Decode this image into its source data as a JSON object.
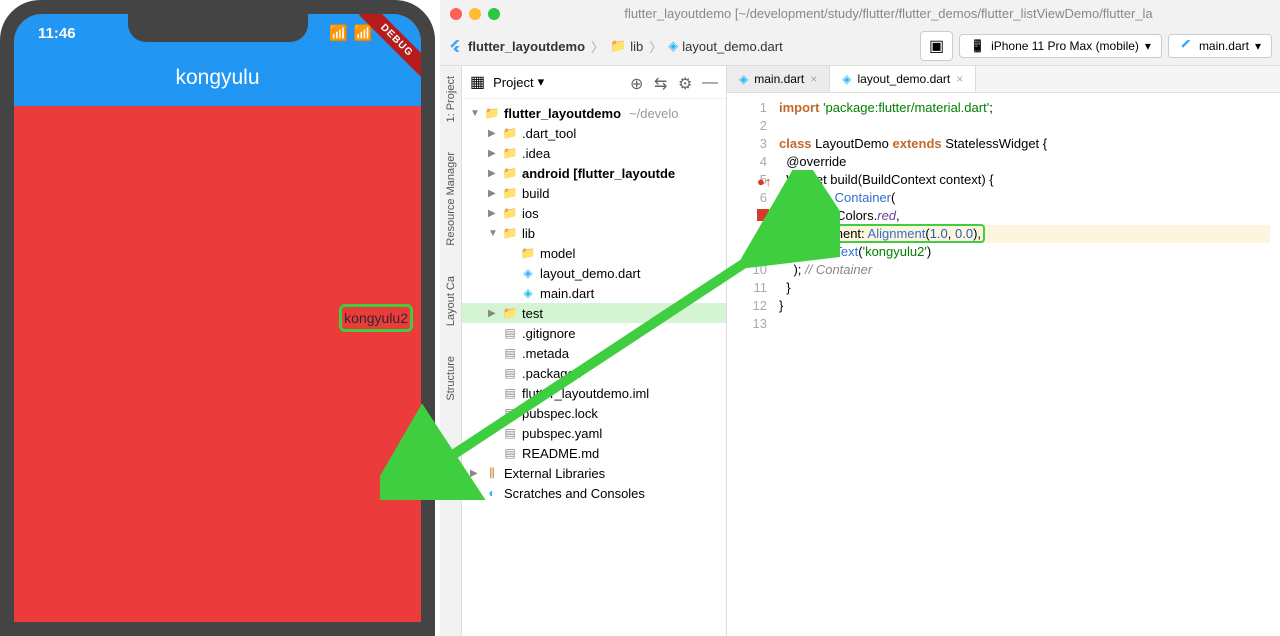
{
  "phone": {
    "time": "11:46",
    "title": "kongyulu",
    "body_text": "kongyulu2",
    "debug": "DEBUG"
  },
  "ide": {
    "window_title": "flutter_layoutdemo [~/development/study/flutter/flutter_demos/flutter_listViewDemo/flutter_la",
    "breadcrumb": [
      "flutter_layoutdemo",
      "lib",
      "layout_demo.dart"
    ],
    "device": "iPhone 11 Pro Max (mobile)",
    "run_config": "main.dart",
    "side_tabs": [
      "1: Project",
      "Resource Manager",
      "Layout Ca",
      "Structure"
    ],
    "project": {
      "title": "Project",
      "root": "flutter_layoutdemo",
      "root_path": "~/develo",
      "tree": [
        {
          "label": ".dart_tool",
          "icon": "folder-special",
          "indent": 1,
          "chevron": "▶"
        },
        {
          "label": ".idea",
          "icon": "folder-special",
          "indent": 1,
          "chevron": "▶"
        },
        {
          "label": "android [flutter_layoutde",
          "icon": "folder-special",
          "indent": 1,
          "chevron": "▶",
          "bold": true
        },
        {
          "label": "build",
          "icon": "folder-special",
          "indent": 1,
          "chevron": "▶"
        },
        {
          "label": "ios",
          "icon": "folder",
          "indent": 1,
          "chevron": "▶"
        },
        {
          "label": "lib",
          "icon": "folder",
          "indent": 1,
          "chevron": "▼"
        },
        {
          "label": "model",
          "icon": "folder",
          "indent": 2,
          "chevron": ""
        },
        {
          "label": "layout_demo.dart",
          "icon": "dart",
          "indent": 2,
          "chevron": ""
        },
        {
          "label": "main.dart",
          "icon": "dart",
          "indent": 2,
          "chevron": ""
        },
        {
          "label": "test",
          "icon": "folder-test",
          "indent": 1,
          "chevron": "▶",
          "selected": true
        },
        {
          "label": ".gitignore",
          "icon": "file",
          "indent": 1,
          "chevron": ""
        },
        {
          "label": ".metada",
          "icon": "file",
          "indent": 1,
          "chevron": ""
        },
        {
          "label": ".packages",
          "icon": "file",
          "indent": 1,
          "chevron": ""
        },
        {
          "label": "flutter_layoutdemo.iml",
          "icon": "file",
          "indent": 1,
          "chevron": ""
        },
        {
          "label": "pubspec.lock",
          "icon": "file",
          "indent": 1,
          "chevron": ""
        },
        {
          "label": "pubspec.yaml",
          "icon": "file",
          "indent": 1,
          "chevron": ""
        },
        {
          "label": "README.md",
          "icon": "file",
          "indent": 1,
          "chevron": ""
        },
        {
          "label": "External Libraries",
          "icon": "lib",
          "indent": 0,
          "chevron": "▶"
        },
        {
          "label": "Scratches and Consoles",
          "icon": "scratch",
          "indent": 0,
          "chevron": ""
        }
      ]
    },
    "tabs": [
      {
        "label": "main.dart",
        "active": false
      },
      {
        "label": "layout_demo.dart",
        "active": true
      }
    ],
    "code": {
      "lines": [
        {
          "n": 1,
          "html": "<span class='kw'>import</span> <span class='str'>'package:flutter/material.dart'</span>;"
        },
        {
          "n": 2,
          "html": ""
        },
        {
          "n": 3,
          "html": "<span class='kw'>class</span> LayoutDemo <span class='kw'>extends</span> StatelessWidget {"
        },
        {
          "n": 4,
          "html": "  @override"
        },
        {
          "n": 5,
          "html": "  Widget build(BuildContext context) {"
        },
        {
          "n": 6,
          "html": "    <span class='kw'>return</span> <span class='type'>Container</span>("
        },
        {
          "n": 7,
          "html": "      color: Colors.<span class='prop'>red</span>,"
        },
        {
          "n": 8,
          "html": "      <span class='ann-box'>alignment: <span class='type'>Alignment</span>(<span class='num'>1.0</span>, <span class='num'>0.0</span>),</span>"
        },
        {
          "n": 9,
          "html": "      child: <span class='type'>Text</span>(<span class='str'>'kongyulu2'</span>)"
        },
        {
          "n": 10,
          "html": "    ); <span class='comment'>// Container</span>"
        },
        {
          "n": 11,
          "html": "  }"
        },
        {
          "n": 12,
          "html": "}"
        },
        {
          "n": 13,
          "html": ""
        }
      ]
    }
  }
}
